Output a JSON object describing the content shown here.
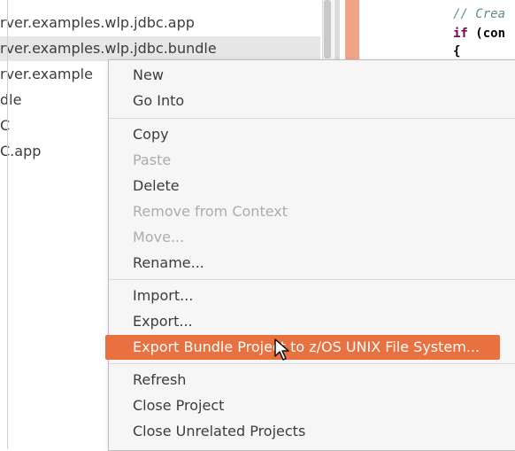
{
  "explorer": {
    "items": [
      {
        "label": "rver.examples.wlp.jdbc.app",
        "selected": false
      },
      {
        "label": "rver.examples.wlp.jdbc.bundle",
        "selected": true
      },
      {
        "label": "rver.example",
        "selected": false
      },
      {
        "label": "dle",
        "selected": false
      },
      {
        "label": "C",
        "selected": false
      },
      {
        "label": "C.app",
        "selected": false
      }
    ]
  },
  "editor": {
    "lines": [
      {
        "text": "// Crea",
        "type": "comment"
      },
      {
        "keyword": "if",
        "text": " (con",
        "type": "code"
      },
      {
        "text": "{",
        "type": "brace"
      }
    ]
  },
  "context_menu": {
    "items": [
      {
        "label": "New",
        "mnemonic": "N",
        "disabled": false
      },
      {
        "label": "Go Into",
        "mnemonic": "I",
        "disabled": false
      },
      {
        "label": "Copy",
        "mnemonic": "",
        "disabled": false
      },
      {
        "label": "Paste",
        "mnemonic": "",
        "disabled": true
      },
      {
        "label": "Delete",
        "mnemonic": "D",
        "disabled": false
      },
      {
        "label": "Remove from Context",
        "mnemonic": "",
        "disabled": true
      },
      {
        "label": "Move...",
        "mnemonic": "",
        "disabled": true
      },
      {
        "label": "Rename...",
        "mnemonic": "m",
        "disabled": false
      },
      {
        "label": "Import...",
        "mnemonic": "I",
        "disabled": false
      },
      {
        "label": "Export...",
        "mnemonic": "o",
        "disabled": false
      },
      {
        "label": "Export Bundle Project to z/OS UNIX File System...",
        "mnemonic": "",
        "disabled": false,
        "highlighted": true
      },
      {
        "label": "Refresh",
        "mnemonic": "f",
        "disabled": false
      },
      {
        "label": "Close Project",
        "mnemonic": "s",
        "disabled": false
      },
      {
        "label": "Close Unrelated Projects",
        "mnemonic": "U",
        "disabled": false
      }
    ],
    "highlight_color": "#e9703f"
  }
}
